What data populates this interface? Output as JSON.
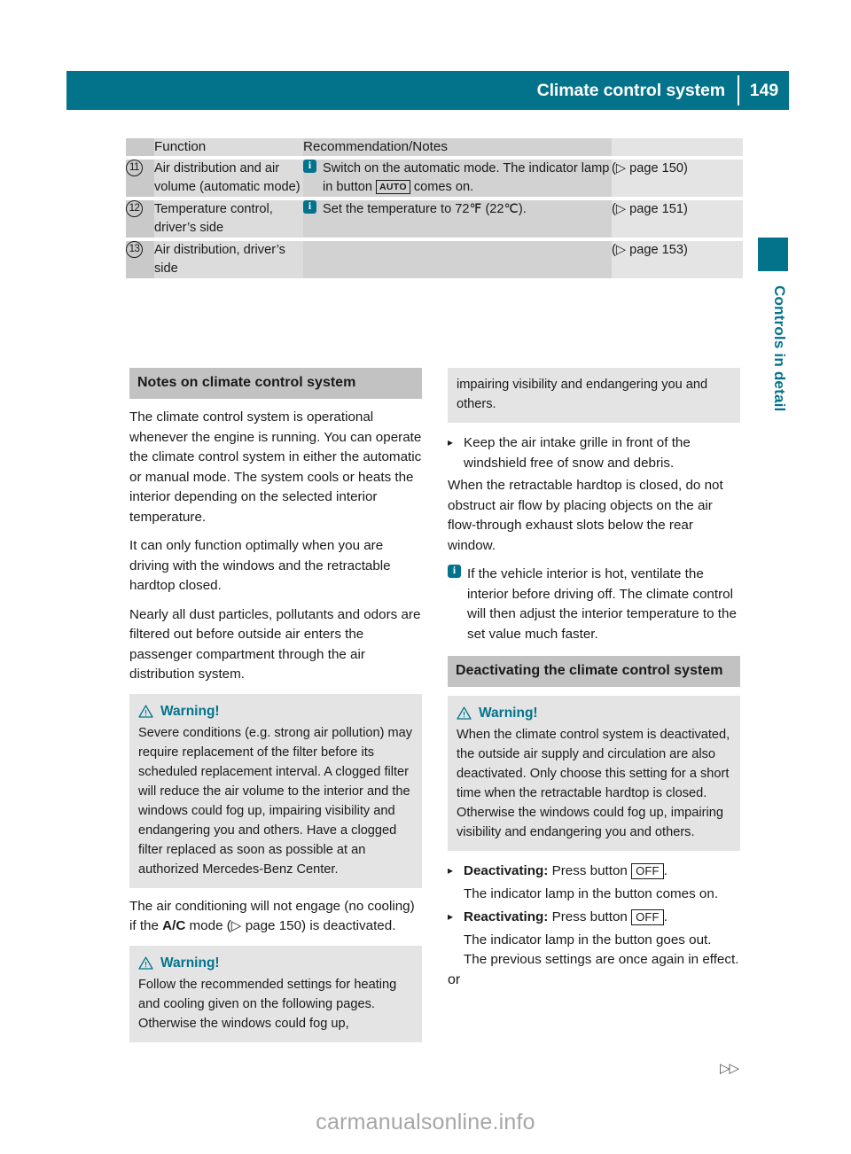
{
  "header": {
    "title": "Climate control system",
    "page_number": "149",
    "accent_color": "#03738c"
  },
  "side_tab": {
    "label": "Controls in detail",
    "color": "#03738c"
  },
  "table": {
    "columns": [
      "",
      "Function",
      "Recommendation/Notes",
      ""
    ],
    "rows": [
      {
        "number": "11",
        "function": "Air distribution and air volume (automatic mode)",
        "icon": "info-icon",
        "recommendation_pre": "Switch on the automatic mode. The indicator lamp in button ",
        "recommendation_button": "AUTO",
        "recommendation_post": " comes on.",
        "reference": "(▷ page 150)"
      },
      {
        "number": "12",
        "function": "Temperature control, driver’s side",
        "icon": "info-icon",
        "recommendation_pre": "Set the temperature to 72℉ (22℃).",
        "recommendation_button": "",
        "recommendation_post": "",
        "reference": "(▷ page 151)"
      },
      {
        "number": "13",
        "function": "Air distribution, driver’s side",
        "icon": "",
        "recommendation_pre": "",
        "recommendation_button": "",
        "recommendation_post": "",
        "reference": "(▷ page 153)"
      }
    ]
  },
  "left_column": {
    "section_heading": "Notes on climate control system",
    "para1": "The climate control system is operational whenever the engine is running. You can operate the climate control system in either the automatic or manual mode. The system cools or heats the interior depending on the selected interior temperature.",
    "para2": "It can only function optimally when you are driving with the windows and the retractable hardtop closed.",
    "para3": "Nearly all dust particles, pollutants and odors are filtered out before outside air enters the passenger compartment through the air distribution system.",
    "warning1": {
      "title": "Warning!",
      "body": "Severe conditions (e.g. strong air pollution) may require replacement of the filter before its scheduled replacement interval. A clogged filter will reduce the air volume to the interior and the windows could fog up, impairing visibility and endangering you and others. Have a clogged filter replaced as soon as possible at an authorized Mercedes-Benz Center."
    },
    "para4_pre": "The air conditioning will not engage (no cooling) if the ",
    "para4_bold": "A/C",
    "para4_post": " mode (▷ page 150) is deactivated.",
    "warning2": {
      "title": "Warning!",
      "body": "Follow the recommended settings for heating and cooling given on the following pages. Otherwise the windows could fog up,"
    }
  },
  "right_column": {
    "warning2_cont": "impairing visibility and endangering you and others.",
    "step1": "Keep the air intake grille in front of the windshield free of snow and debris.",
    "para1": "When the retractable hardtop is closed, do not obstruct air flow by placing objects on the air flow-through exhaust slots below the rear window.",
    "note1": "If the vehicle interior is hot, ventilate the interior before driving off. The climate control will then adjust the interior temperature to the set value much faster.",
    "section_heading": "Deactivating the climate control system",
    "warning3": {
      "title": "Warning!",
      "body": "When the climate control system is deactivated, the outside air supply and circulation are also deactivated. Only choose this setting for a short time when the retractable hardtop is closed. Otherwise the windows could fog up, impairing visibility and endangering you and others."
    },
    "deactivating_label": "Deactivating:",
    "deactivating_text_pre": " Press button ",
    "deactivating_button": "OFF",
    "deactivating_text_post": ".",
    "deactivating_result": "The indicator lamp in the button comes on.",
    "reactivating_label": "Reactivating:",
    "reactivating_text_pre": " Press button ",
    "reactivating_button": "OFF",
    "reactivating_text_post": ".",
    "reactivating_result_1": "The indicator lamp in the button goes out.",
    "reactivating_result_2": "The previous settings are once again in effect.",
    "or_text": "or"
  },
  "footer": {
    "continuation_marker": "▷▷",
    "watermark": "carmanualsonline.info"
  }
}
